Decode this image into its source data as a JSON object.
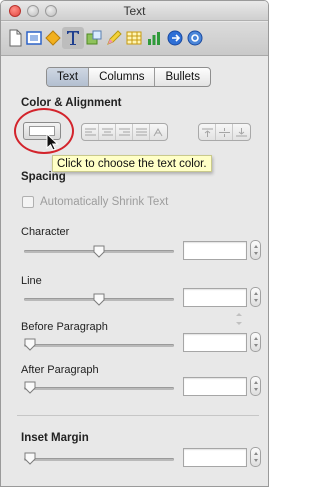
{
  "window": {
    "title": "Text"
  },
  "toolbar": {
    "icons": [
      "document-icon",
      "layout-icon",
      "graphic-icon",
      "text-icon",
      "wrap-icon",
      "pen-icon",
      "table-icon",
      "chart-icon",
      "link-icon",
      "info-icon"
    ],
    "selected": "text-icon"
  },
  "tabs": [
    {
      "label": "Text",
      "active": true
    },
    {
      "label": "Columns",
      "active": false
    },
    {
      "label": "Bullets",
      "active": false
    }
  ],
  "color_alignment": {
    "heading": "Color & Alignment",
    "tooltip": "Click to choose the text color.",
    "text_color": "#ffffff"
  },
  "spacing": {
    "heading": "Spacing",
    "auto_shrink_label": "Automatically Shrink Text",
    "auto_shrink_checked": false,
    "character": {
      "label": "Character",
      "value": "",
      "level": 0.5
    },
    "line": {
      "label": "Line",
      "value": "",
      "level": 0.5
    },
    "before_paragraph": {
      "label": "Before Paragraph",
      "value": "",
      "level": 0.0
    },
    "after_paragraph": {
      "label": "After Paragraph",
      "value": "",
      "level": 0.0
    }
  },
  "inset": {
    "heading": "Inset Margin",
    "value": "",
    "level": 0.0
  },
  "colors": {
    "highlight_ring": "#d3242c",
    "tooltip_bg": "#ffffc6"
  }
}
